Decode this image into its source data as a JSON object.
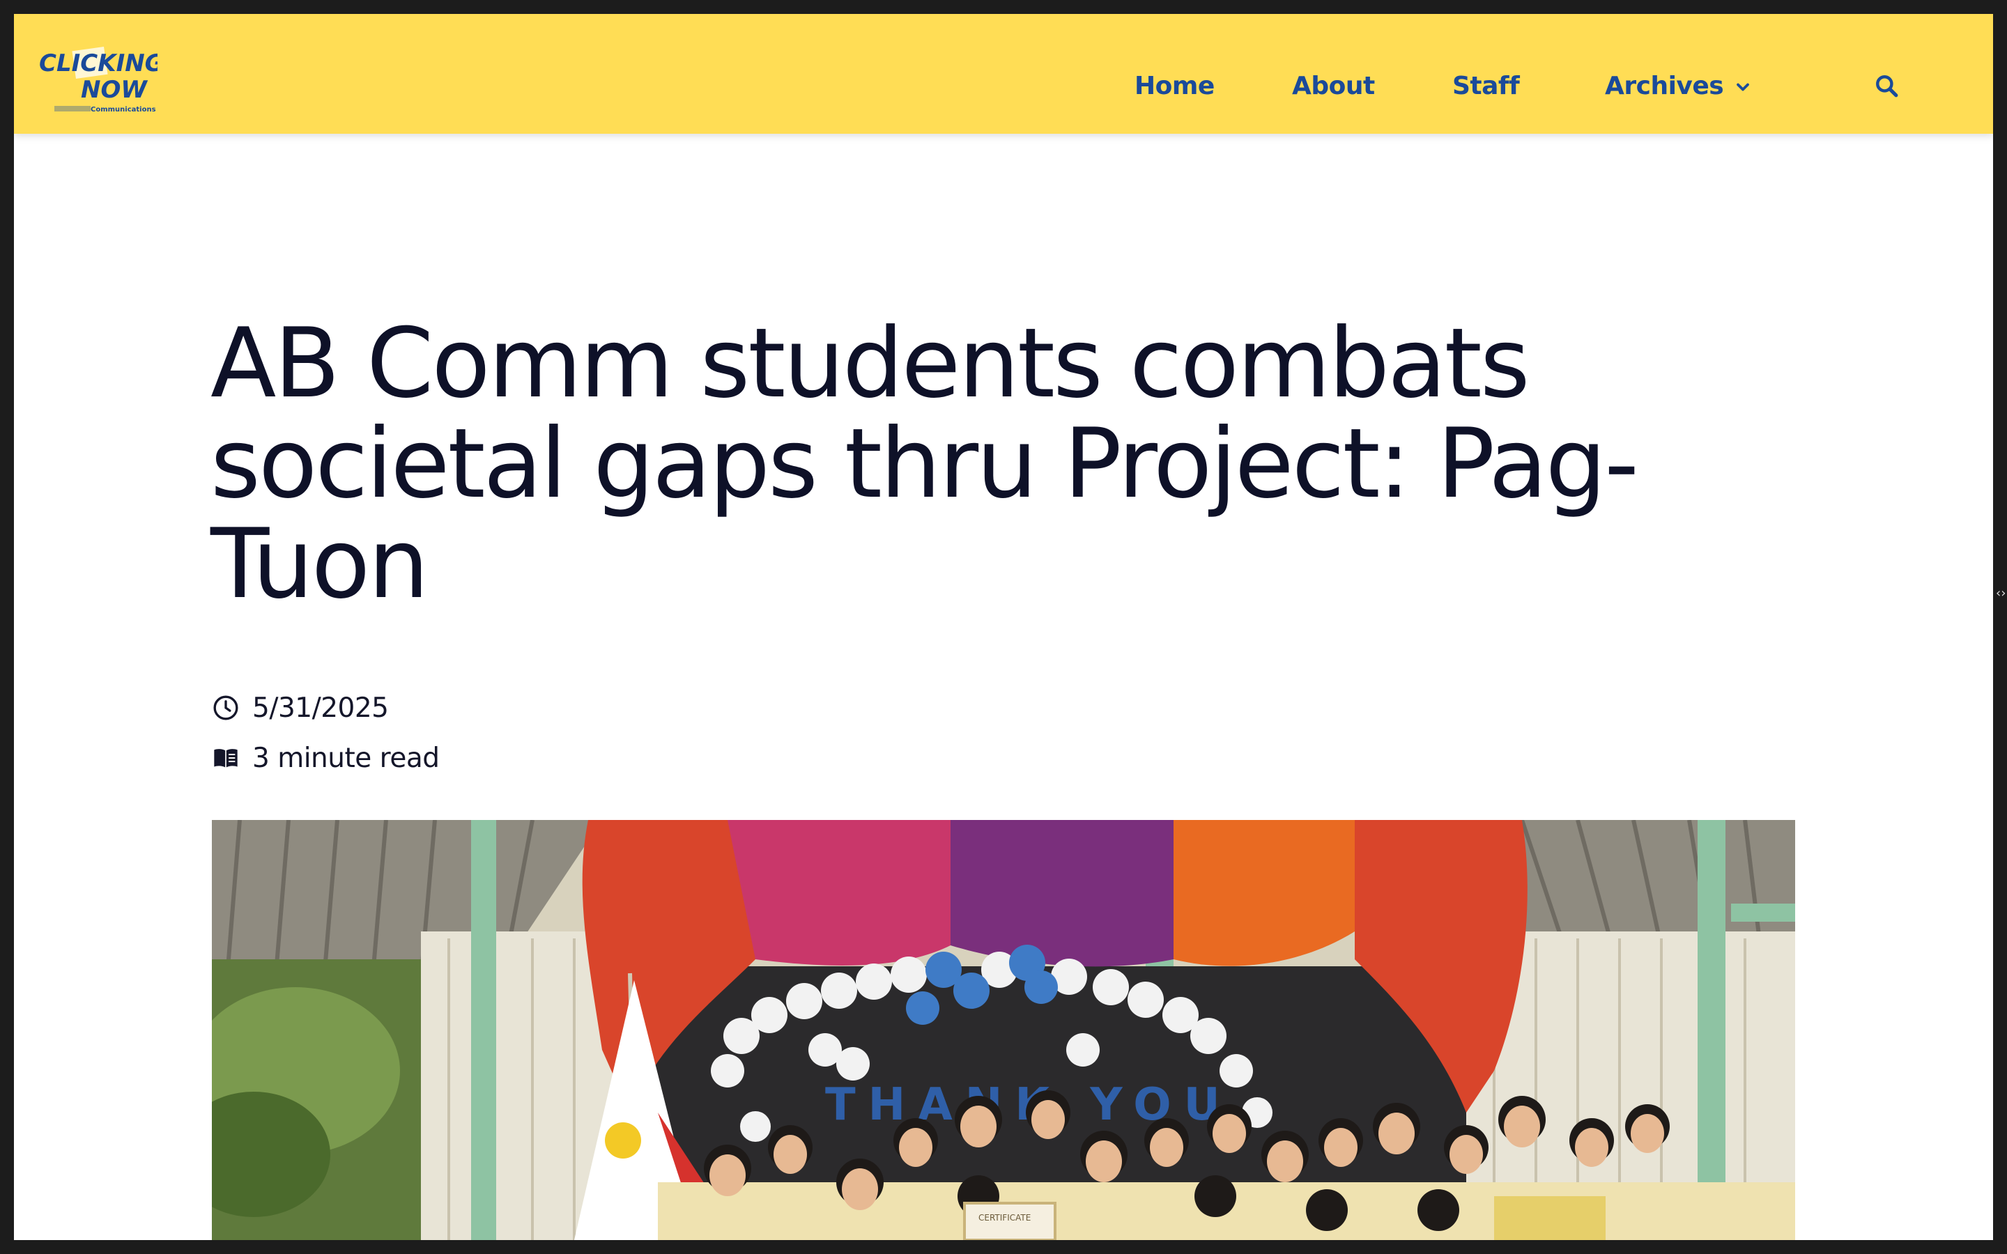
{
  "site": {
    "logo_icon": "clicking-now-logo",
    "logo_text_line1": "CLICKING",
    "logo_text_line2": "NOW",
    "logo_tagline": "Communications"
  },
  "nav": {
    "items": [
      {
        "label": "Home"
      },
      {
        "label": "About"
      },
      {
        "label": "Staff"
      },
      {
        "label": "Archives",
        "icon": "chevron-down-icon"
      }
    ],
    "search_icon": "search-icon"
  },
  "article": {
    "title": "AB Comm students combats societal gaps thru Project: Pag-Tuon",
    "date": "5/31/2025",
    "date_icon": "clock-icon",
    "read_time": "3 minute read",
    "read_icon": "book-icon",
    "hero_image": "group-photo",
    "hero_banner_text": "THANK YOU",
    "hero_certificate_text": "CERTIFICATE"
  },
  "colors": {
    "header_bg": "#ffdd55",
    "nav_text": "#1a4a9a",
    "title_text": "#0e1128"
  }
}
